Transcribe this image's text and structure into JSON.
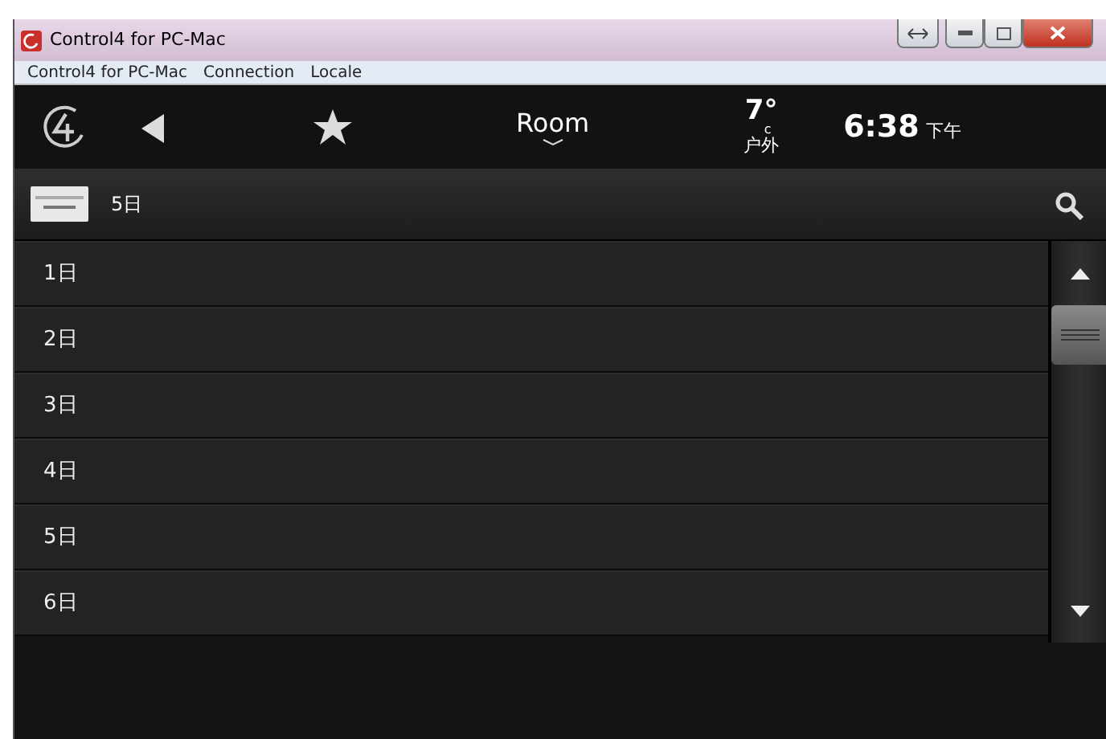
{
  "window": {
    "title": "Control4 for PC-Mac"
  },
  "menu": [
    "Control4 for PC-Mac",
    "Connection",
    "Locale"
  ],
  "header": {
    "room": "Room",
    "temperature": "7°",
    "unit": "c",
    "weather_label": "户外",
    "time": "6:38",
    "period": "下午"
  },
  "subheader": {
    "title": "5日"
  },
  "list": {
    "items": [
      {
        "label": "1日"
      },
      {
        "label": "2日"
      },
      {
        "label": "3日"
      },
      {
        "label": "4日"
      },
      {
        "label": "5日"
      },
      {
        "label": "6日"
      }
    ]
  }
}
